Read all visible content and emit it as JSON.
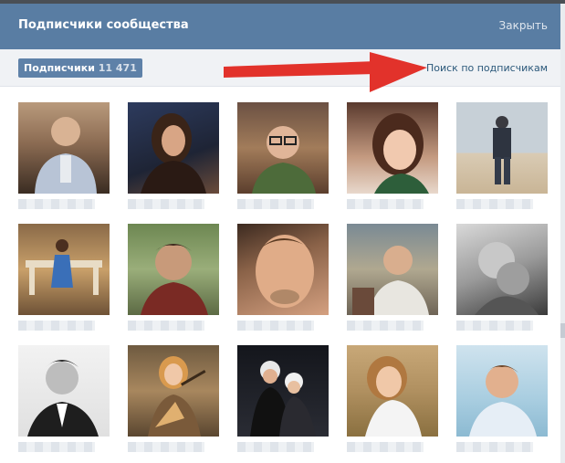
{
  "header": {
    "title": "Подписчики сообщества",
    "close_label": "Закрыть"
  },
  "tabs": {
    "subscribers_label": "Подписчики",
    "subscribers_count": "11 471"
  },
  "search": {
    "link_label": "Поиск по подписчикам"
  },
  "colors": {
    "header_bg": "#597da3",
    "arrow": "#e2322b",
    "tab_bg": "#5e81a8",
    "link": "#2b587a"
  },
  "grid": {
    "rows": 3,
    "columns": 5,
    "cards": [
      {
        "photo": "man-in-suit-photo"
      },
      {
        "photo": "woman-dark-hair-photo"
      },
      {
        "photo": "man-glasses-photo"
      },
      {
        "photo": "woman-smiling-photo"
      },
      {
        "photo": "man-on-beach-photo"
      },
      {
        "photo": "woman-blue-dress-photo"
      },
      {
        "photo": "man-outdoors-photo"
      },
      {
        "photo": "man-closeup-photo"
      },
      {
        "photo": "man-at-table-photo"
      },
      {
        "photo": "couple-bw-photo"
      },
      {
        "photo": "man-bw-portrait-photo"
      },
      {
        "photo": "woman-balalaika-photo"
      },
      {
        "photo": "couple-winter-photo"
      },
      {
        "photo": "woman-outdoor-photo"
      },
      {
        "photo": "man-smiling-photo"
      }
    ]
  }
}
